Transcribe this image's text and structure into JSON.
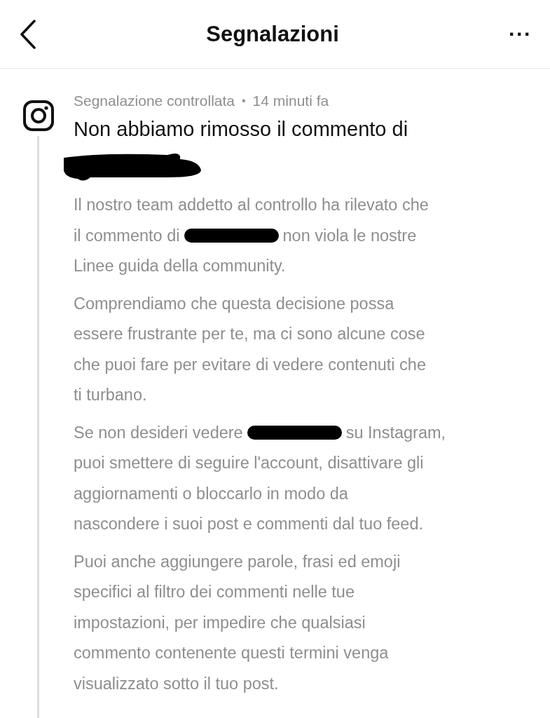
{
  "header": {
    "title": "Segnalazioni",
    "more": "···"
  },
  "report": {
    "status": "Segnalazione controllata",
    "separator": "•",
    "time": "14 minuti fa",
    "title": "Non abbiamo rimosso il commento di",
    "paragraphs": [
      {
        "lines": [
          {
            "text": "Il nostro team addetto al controllo ha rilevato che"
          },
          {
            "text": "il commento di",
            "after": "non viola le nostre"
          },
          {
            "text": "Linee guida della community."
          }
        ]
      },
      {
        "lines": [
          {
            "text": "Comprendiamo che questa decisione possa"
          },
          {
            "text": "essere frustrante per te, ma ci sono alcune cose"
          },
          {
            "text": "che puoi fare per evitare di vedere contenuti che"
          },
          {
            "text": "ti turbano."
          }
        ]
      },
      {
        "lines": [
          {
            "text": "Se non desideri vedere",
            "after": "su Instagram,"
          },
          {
            "text": "puoi smettere di seguire l'account, disattivare gli"
          },
          {
            "text": "aggiornamenti o bloccarlo in modo da"
          },
          {
            "text": "nascondere i suoi post e commenti dal tuo feed."
          }
        ]
      },
      {
        "lines": [
          {
            "text": "Puoi anche aggiungere parole, frasi ed emoji"
          },
          {
            "text": "specifici al filtro dei commenti nelle tue"
          },
          {
            "text": "impostazioni, per impedire che qualsiasi"
          },
          {
            "text": "commento contenente questi termini venga"
          },
          {
            "text": "visualizzato sotto il tuo post."
          }
        ]
      }
    ]
  }
}
